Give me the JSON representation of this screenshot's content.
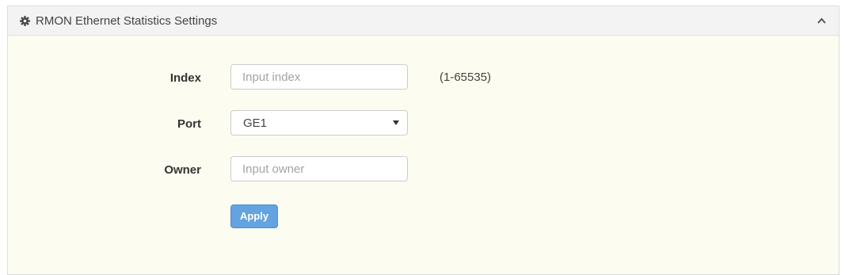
{
  "panel": {
    "title": "RMON Ethernet Statistics Settings",
    "header_icon": "gear-icon",
    "collapse_icon": "chevron-up-icon"
  },
  "form": {
    "index": {
      "label": "Index",
      "placeholder": "Input index",
      "value": "",
      "hint": "(1-65535)"
    },
    "port": {
      "label": "Port",
      "selected": "GE1"
    },
    "owner": {
      "label": "Owner",
      "placeholder": "Input owner",
      "value": ""
    },
    "apply_label": "Apply"
  },
  "colors": {
    "panel_background": "#fcfcf0",
    "header_background": "#f3f3f3",
    "apply_button": "#63a3e0"
  }
}
